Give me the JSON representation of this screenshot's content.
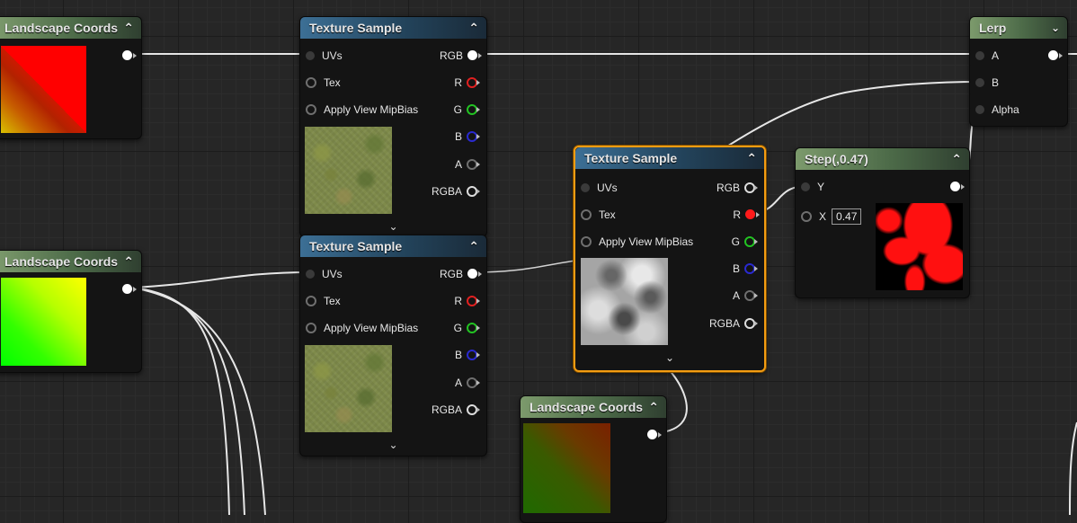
{
  "nodes": {
    "lc1": {
      "title": "Landscape Coords"
    },
    "lc2": {
      "title": "Landscape Coords"
    },
    "lc3": {
      "title": "Landscape Coords"
    },
    "ts1": {
      "title": "Texture Sample",
      "inputs": [
        "UVs",
        "Tex",
        "Apply View MipBias"
      ],
      "outputs": [
        "RGB",
        "R",
        "G",
        "B",
        "A",
        "RGBA"
      ]
    },
    "ts2": {
      "title": "Texture Sample",
      "inputs": [
        "UVs",
        "Tex",
        "Apply View MipBias"
      ],
      "outputs": [
        "RGB",
        "R",
        "G",
        "B",
        "A",
        "RGBA"
      ]
    },
    "ts3": {
      "title": "Texture Sample",
      "inputs": [
        "UVs",
        "Tex",
        "Apply View MipBias"
      ],
      "outputs": [
        "RGB",
        "R",
        "G",
        "B",
        "A",
        "RGBA"
      ]
    },
    "step": {
      "title": "Step(,0.47)",
      "inputs": [
        "Y",
        "X"
      ],
      "x_value": "0.47"
    },
    "lerp": {
      "title": "Lerp",
      "inputs": [
        "A",
        "B",
        "Alpha"
      ]
    }
  },
  "icons": {
    "collapse": "chevron-up-icon",
    "lerp_collapse": "chevron-down-icon",
    "expand": "chevron-down-icon"
  },
  "colors": {
    "selection": "#f39c12",
    "pin_red": "#ff1a1a",
    "pin_green": "#22c322",
    "pin_blue": "#2a2ad0",
    "wire": "#e6e6e6"
  }
}
